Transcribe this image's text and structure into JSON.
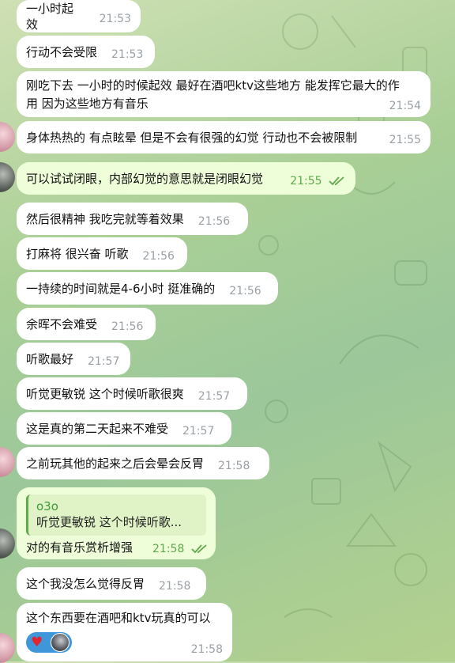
{
  "messages": [
    {
      "text": "一小时起效",
      "time": "21:53"
    },
    {
      "text": "行动不会受限",
      "time": "21:53"
    },
    {
      "line1": "刚吃下去 一小时的时候起效 最好在酒吧ktv这些地方 能发挥它最大的作",
      "line2": "用 因为这些地方有音乐",
      "time": "21:54"
    },
    {
      "text": "身体热热的 有点眩晕 但是不会有很强的幻觉 行动也不会被限制",
      "time": "21:55"
    },
    {
      "text": "可以试试闭眼，内部幻觉的意思就是闭眼幻觉",
      "time": "21:55"
    },
    {
      "text": "然后很精神 我吃完就等着效果",
      "time": "21:56"
    },
    {
      "text": "打麻将 很兴奋 听歌",
      "time": "21:56"
    },
    {
      "text": "一持续的时间就是4-6小时 挺准确的",
      "time": "21:56"
    },
    {
      "text": "余晖不会难受",
      "time": "21:56"
    },
    {
      "text": "听歌最好",
      "time": "21:57"
    },
    {
      "text": "听觉更敏锐 这个时候听歌很爽",
      "time": "21:57"
    },
    {
      "text": "这是真的第二天起来不难受",
      "time": "21:57"
    },
    {
      "text": "之前玩其他的起来之后会晕会反胃",
      "time": "21:58"
    },
    {
      "quote_name": "o3o",
      "quote_text": "听觉更敏锐 这个时候听歌...",
      "text": "对的有音乐赏析增强",
      "time": "21:58"
    },
    {
      "text": "这个我没怎么觉得反胃",
      "time": "21:58"
    },
    {
      "text": "这个东西要在酒吧和ktv玩真的可以",
      "time": "21:58"
    }
  ],
  "colors": {
    "incoming_bubble": "#ffffff",
    "outgoing_bubble": "#eefed9",
    "outgoing_time": "#5ea84a",
    "incoming_time": "#9aa1a6",
    "quote_accent": "#5cad46",
    "reaction_pill": "#3f96d8"
  },
  "icons": {
    "read_receipt": "double-check-icon",
    "reaction": "red-heart-icon"
  }
}
